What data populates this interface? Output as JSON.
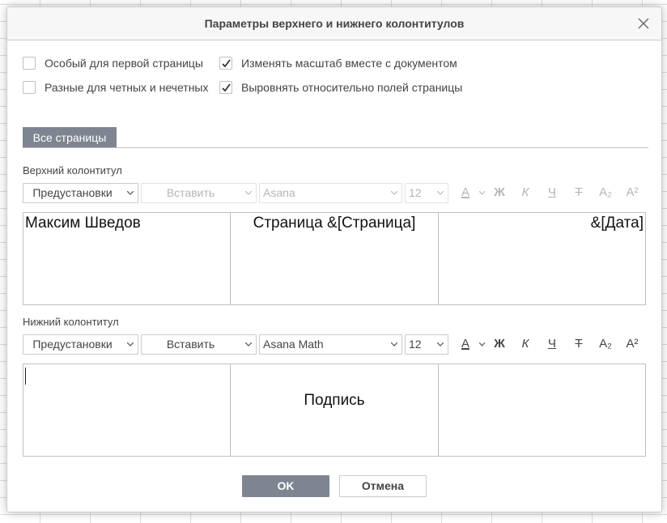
{
  "dialog": {
    "title": "Параметры верхнего и нижнего колонтитулов"
  },
  "options": [
    {
      "label": "Особый для первой страницы",
      "checked": false
    },
    {
      "label": "Разные для четных и нечетных",
      "checked": false
    },
    {
      "label": "Изменять масштаб вместе с документом",
      "checked": true
    },
    {
      "label": "Выровнять относительно полей страницы",
      "checked": true
    }
  ],
  "tab": {
    "label": "Все страницы"
  },
  "header": {
    "label": "Верхний колонтитул",
    "toolbar": {
      "presets": "Предустановки",
      "insert": "Вставить",
      "font": "Asana",
      "size": "12",
      "enabled": false
    },
    "left": "Максим Шведов",
    "center": "Страница &[Страница]",
    "right": "&[Дата]"
  },
  "footer": {
    "label": "Нижний колонтитул",
    "toolbar": {
      "presets": "Предустановки",
      "insert": "Вставить",
      "font": "Asana Math",
      "size": "12",
      "enabled": true
    },
    "left": "",
    "center": "Подпись",
    "right": ""
  },
  "format": {
    "font_color": "A",
    "bold": "Ж",
    "italic": "К",
    "underline": "Ч",
    "strike": "Т",
    "subscript": "A₂",
    "superscript": "A²"
  },
  "buttons": {
    "ok": "OK",
    "cancel": "Отмена"
  },
  "colors": {
    "accent": "#7e8590",
    "border": "#c0c0c0"
  },
  "icons": {
    "close": "close-icon",
    "check": "checkmark-icon",
    "caret": "chevron-down-icon"
  }
}
